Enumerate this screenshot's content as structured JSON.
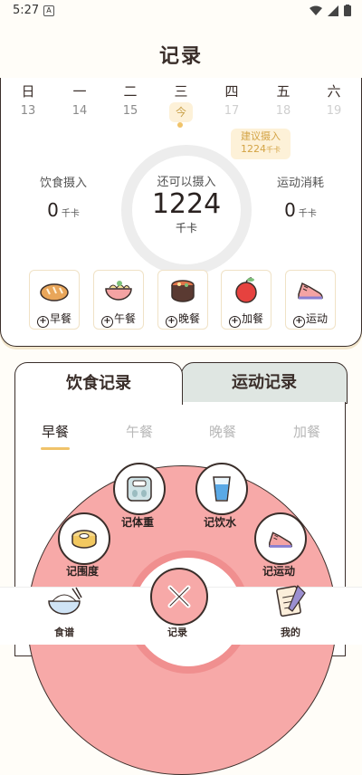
{
  "status_bar": {
    "time": "5:27"
  },
  "header": {
    "title": "记录"
  },
  "week": {
    "days": [
      {
        "name": "日",
        "date": "13"
      },
      {
        "name": "一",
        "date": "14"
      },
      {
        "name": "二",
        "date": "15"
      },
      {
        "name": "三",
        "date": "今"
      },
      {
        "name": "四",
        "date": "17"
      },
      {
        "name": "五",
        "date": "18"
      },
      {
        "name": "六",
        "date": "19"
      }
    ]
  },
  "summary": {
    "suggest_label": "建议摄入",
    "suggest_value": "1224",
    "suggest_unit": "千卡",
    "remaining_label": "还可以摄入",
    "remaining_value": "1224",
    "remaining_unit": "千卡",
    "intake_label": "饮食摄入",
    "intake_value": "0",
    "intake_unit": "千卡",
    "burn_label": "运动消耗",
    "burn_value": "0",
    "burn_unit": "千卡"
  },
  "meals": [
    {
      "label": "早餐",
      "icon": "bread-icon"
    },
    {
      "label": "午餐",
      "icon": "noodle-bowl-icon"
    },
    {
      "label": "晚餐",
      "icon": "pot-icon"
    },
    {
      "label": "加餐",
      "icon": "apple-icon"
    },
    {
      "label": "运动",
      "icon": "sneaker-icon"
    }
  ],
  "tabs": {
    "diet": "饮食记录",
    "sport": "运动记录"
  },
  "subtabs": [
    "早餐",
    "午餐",
    "晚餐",
    "加餐"
  ],
  "quick_actions": {
    "weight": "记体重",
    "water": "记饮水",
    "girth": "记围度",
    "exercise": "记运动"
  },
  "bottom_nav": {
    "recipes": "食谱",
    "record": "记录",
    "mine": "我的"
  },
  "colors": {
    "accent": "#f0c36a",
    "pink": "#f7a9a8",
    "tab_inactive": "#dfe6e2"
  }
}
